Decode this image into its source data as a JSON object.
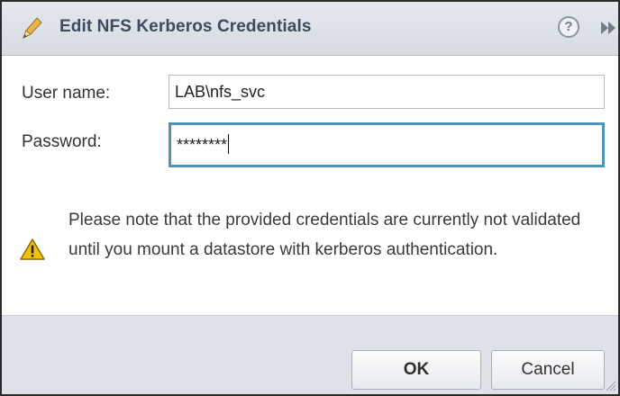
{
  "dialog": {
    "title": "Edit NFS Kerberos Credentials",
    "title_icon": "pencil-icon",
    "help_icon": "help-icon",
    "help_glyph": "?",
    "popout_icon": "double-chevron-right-icon"
  },
  "form": {
    "username_label": "User name:",
    "username_value": "LAB\\nfs_svc",
    "password_label": "Password:",
    "password_value": "********"
  },
  "note": {
    "icon": "warning-icon",
    "text": "Please note that the provided credentials are currently not validated until you mount a datastore with kerberos authentication."
  },
  "buttons": {
    "ok_label": "OK",
    "cancel_label": "Cancel"
  },
  "colors": {
    "focus_border": "#4e94b6",
    "title_text": "#3d4b5c",
    "warning_fill": "#f2c200"
  }
}
